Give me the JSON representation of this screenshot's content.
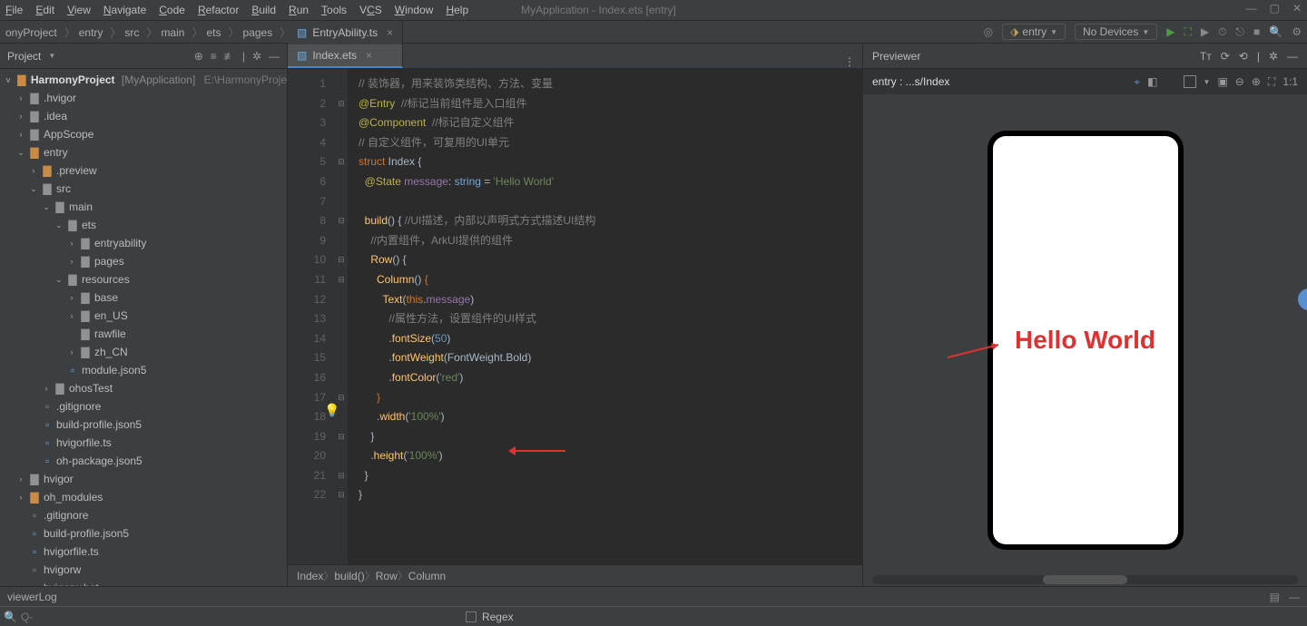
{
  "menu": {
    "items": [
      "File",
      "Edit",
      "View",
      "Navigate",
      "Code",
      "Refactor",
      "Build",
      "Run",
      "Tools",
      "VCS",
      "Window",
      "Help"
    ],
    "underline": [
      0,
      0,
      0,
      0,
      0,
      0,
      0,
      0,
      0,
      1,
      0,
      0
    ],
    "window_title": "MyApplication - Index.ets [entry]"
  },
  "navcrumbs": [
    "onyProject",
    "entry",
    "src",
    "main",
    "ets",
    "pages"
  ],
  "navfile": "Index.ets",
  "runcfg": "entry",
  "devices": "No Devices",
  "project": {
    "header": "Project",
    "root_name": "HarmonyProject",
    "root_sub": "[MyApplication]",
    "root_path": "E:\\HarmonyProje",
    "nodes": [
      {
        "d": 1,
        "tw": ">",
        "ic": "fold-grey",
        "lbl": ".hvigor"
      },
      {
        "d": 1,
        "tw": ">",
        "ic": "fold-grey",
        "lbl": ".idea"
      },
      {
        "d": 1,
        "tw": ">",
        "ic": "fold-grey",
        "lbl": "AppScope"
      },
      {
        "d": 1,
        "tw": "v",
        "ic": "fold-orange",
        "lbl": "entry"
      },
      {
        "d": 2,
        "tw": ">",
        "ic": "fold-orange",
        "lbl": ".preview"
      },
      {
        "d": 2,
        "tw": "v",
        "ic": "fold-grey",
        "lbl": "src"
      },
      {
        "d": 3,
        "tw": "v",
        "ic": "fold-grey",
        "lbl": "main"
      },
      {
        "d": 4,
        "tw": "v",
        "ic": "fold-grey",
        "lbl": "ets"
      },
      {
        "d": 5,
        "tw": ">",
        "ic": "fold-grey",
        "lbl": "entryability"
      },
      {
        "d": 5,
        "tw": ">",
        "ic": "fold-grey",
        "lbl": "pages"
      },
      {
        "d": 4,
        "tw": "v",
        "ic": "fold-grey",
        "lbl": "resources"
      },
      {
        "d": 5,
        "tw": ">",
        "ic": "fold-grey",
        "lbl": "base"
      },
      {
        "d": 5,
        "tw": ">",
        "ic": "fold-grey",
        "lbl": "en_US"
      },
      {
        "d": 5,
        "tw": "",
        "ic": "fold-grey",
        "lbl": "rawfile"
      },
      {
        "d": 5,
        "tw": ">",
        "ic": "fold-grey",
        "lbl": "zh_CN"
      },
      {
        "d": 4,
        "tw": "",
        "ic": "file-blue",
        "lbl": "module.json5"
      },
      {
        "d": 3,
        "tw": ">",
        "ic": "fold-grey",
        "lbl": "ohosTest"
      },
      {
        "d": 2,
        "tw": "",
        "ic": "file-grey",
        "lbl": ".gitignore"
      },
      {
        "d": 2,
        "tw": "",
        "ic": "file-blue",
        "lbl": "build-profile.json5"
      },
      {
        "d": 2,
        "tw": "",
        "ic": "file-blue",
        "lbl": "hvigorfile.ts"
      },
      {
        "d": 2,
        "tw": "",
        "ic": "file-blue",
        "lbl": "oh-package.json5"
      },
      {
        "d": 1,
        "tw": ">",
        "ic": "fold-grey",
        "lbl": "hvigor"
      },
      {
        "d": 1,
        "tw": ">",
        "ic": "fold-orange",
        "lbl": "oh_modules"
      },
      {
        "d": 1,
        "tw": "",
        "ic": "file-grey",
        "lbl": ".gitignore"
      },
      {
        "d": 1,
        "tw": "",
        "ic": "file-blue",
        "lbl": "build-profile.json5"
      },
      {
        "d": 1,
        "tw": "",
        "ic": "file-blue",
        "lbl": "hvigorfile.ts"
      },
      {
        "d": 1,
        "tw": "",
        "ic": "file-grey",
        "lbl": "hvigorw"
      },
      {
        "d": 1,
        "tw": "",
        "ic": "file-grey",
        "lbl": "hvigorw.bat"
      }
    ]
  },
  "tabs": [
    {
      "name": "EntryAbility.ts",
      "active": false
    },
    {
      "name": "Index.ets",
      "active": true
    }
  ],
  "code_lines": 22,
  "code": [
    [
      [
        "c-cmt",
        "// 装饰器，用来装饰类结构、方法、变量"
      ]
    ],
    [
      [
        "c-dec",
        "@Entry"
      ],
      [
        "c-cmt",
        "  //标记当前组件是入口组件"
      ]
    ],
    [
      [
        "c-dec",
        "@Component"
      ],
      [
        "c-cmt",
        "  //标记自定义组件"
      ]
    ],
    [
      [
        "c-cmt",
        "// 自定义组件，可复用的UI单元"
      ]
    ],
    [
      [
        "c-kw",
        "struct "
      ],
      [
        "c-cls",
        "Index "
      ],
      [
        "c-pun",
        "{"
      ]
    ],
    [
      [
        "c-pun",
        "  "
      ],
      [
        "c-dec",
        "@State"
      ],
      [
        "c-pun",
        " "
      ],
      [
        "c-id",
        "message"
      ],
      [
        "c-pun",
        ": "
      ],
      [
        "c-type",
        "string"
      ],
      [
        "c-pun",
        " = "
      ],
      [
        "c-str",
        "'Hello World'"
      ]
    ],
    [
      [
        "c-pun",
        ""
      ]
    ],
    [
      [
        "c-pun",
        "  "
      ],
      [
        "c-fn",
        "build"
      ],
      [
        "c-pun",
        "() { "
      ],
      [
        "c-cmt",
        "//UI描述，内部以声明式方式描述UI结构"
      ]
    ],
    [
      [
        "c-pun",
        "    "
      ],
      [
        "c-cmt",
        "//内置组件，ArkUI提供的组件"
      ]
    ],
    [
      [
        "c-pun",
        "    "
      ],
      [
        "c-fn",
        "Row"
      ],
      [
        "c-pun",
        "() {"
      ]
    ],
    [
      [
        "c-pun",
        "      "
      ],
      [
        "c-fn",
        "Column"
      ],
      [
        "c-pun",
        "() "
      ],
      [
        "c-kw",
        "{"
      ]
    ],
    [
      [
        "c-pun",
        "        "
      ],
      [
        "c-fn",
        "Text"
      ],
      [
        "c-pun",
        "("
      ],
      [
        "c-kw",
        "this"
      ],
      [
        "c-pun",
        "."
      ],
      [
        "c-id",
        "message"
      ],
      [
        "c-pun",
        ")"
      ]
    ],
    [
      [
        "c-pun",
        "          "
      ],
      [
        "c-cmt",
        "//属性方法，设置组件的UI样式"
      ]
    ],
    [
      [
        "c-pun",
        "          ."
      ],
      [
        "c-fn",
        "fontSize"
      ],
      [
        "c-pun",
        "("
      ],
      [
        "c-num",
        "50"
      ],
      [
        "c-pun",
        ")"
      ]
    ],
    [
      [
        "c-pun",
        "          ."
      ],
      [
        "c-fn",
        "fontWeight"
      ],
      [
        "c-pun",
        "(FontWeight.Bold)"
      ]
    ],
    [
      [
        "c-pun",
        "          ."
      ],
      [
        "c-fn",
        "fontColor"
      ],
      [
        "c-pun",
        "("
      ],
      [
        "c-str",
        "'red'"
      ],
      [
        "c-pun",
        ")"
      ]
    ],
    [
      [
        "c-pun",
        "      "
      ],
      [
        "c-kw",
        "}"
      ]
    ],
    [
      [
        "c-pun",
        "      ."
      ],
      [
        "c-fn",
        "width"
      ],
      [
        "c-pun",
        "("
      ],
      [
        "c-str",
        "'100%'"
      ],
      [
        "c-pun",
        ")"
      ]
    ],
    [
      [
        "c-pun",
        "    }"
      ]
    ],
    [
      [
        "c-pun",
        "    ."
      ],
      [
        "c-fn",
        "height"
      ],
      [
        "c-pun",
        "("
      ],
      [
        "c-str",
        "'100%'"
      ],
      [
        "c-pun",
        ")"
      ]
    ],
    [
      [
        "c-pun",
        "  }"
      ]
    ],
    [
      [
        "c-pun",
        "}"
      ]
    ]
  ],
  "fold": [
    "",
    "⊟",
    "",
    "",
    "⊟",
    "",
    "",
    "⊟",
    "",
    "⊟",
    "⊟",
    "",
    "",
    "",
    "",
    "",
    "⊟",
    "",
    "⊟",
    "",
    "⊟",
    "⊟"
  ],
  "editor_crumbs": [
    "Index",
    "build()",
    "Row",
    "Column"
  ],
  "previewer": {
    "title": "Previewer",
    "entry": "entry : ...s/Index",
    "ratio": "1:1",
    "hello": "Hello World"
  },
  "log": "viewerLog",
  "search": {
    "placeholder": "Q-",
    "regex": "Regex"
  }
}
